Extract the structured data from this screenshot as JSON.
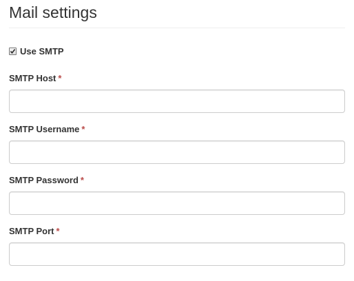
{
  "page": {
    "title": "Mail settings"
  },
  "use_smtp": {
    "label": "Use SMTP",
    "checked": true
  },
  "fields": [
    {
      "label": "SMTP Host",
      "required_mark": "*",
      "value": "",
      "placeholder": ""
    },
    {
      "label": "SMTP Username",
      "required_mark": "*",
      "value": "",
      "placeholder": ""
    },
    {
      "label": "SMTP Password",
      "required_mark": "*",
      "value": "",
      "placeholder": ""
    },
    {
      "label": "SMTP Port",
      "required_mark": "*",
      "value": "",
      "placeholder": ""
    }
  ],
  "colors": {
    "required": "#b94a48",
    "input_border": "#cccccc",
    "text": "#333333"
  }
}
